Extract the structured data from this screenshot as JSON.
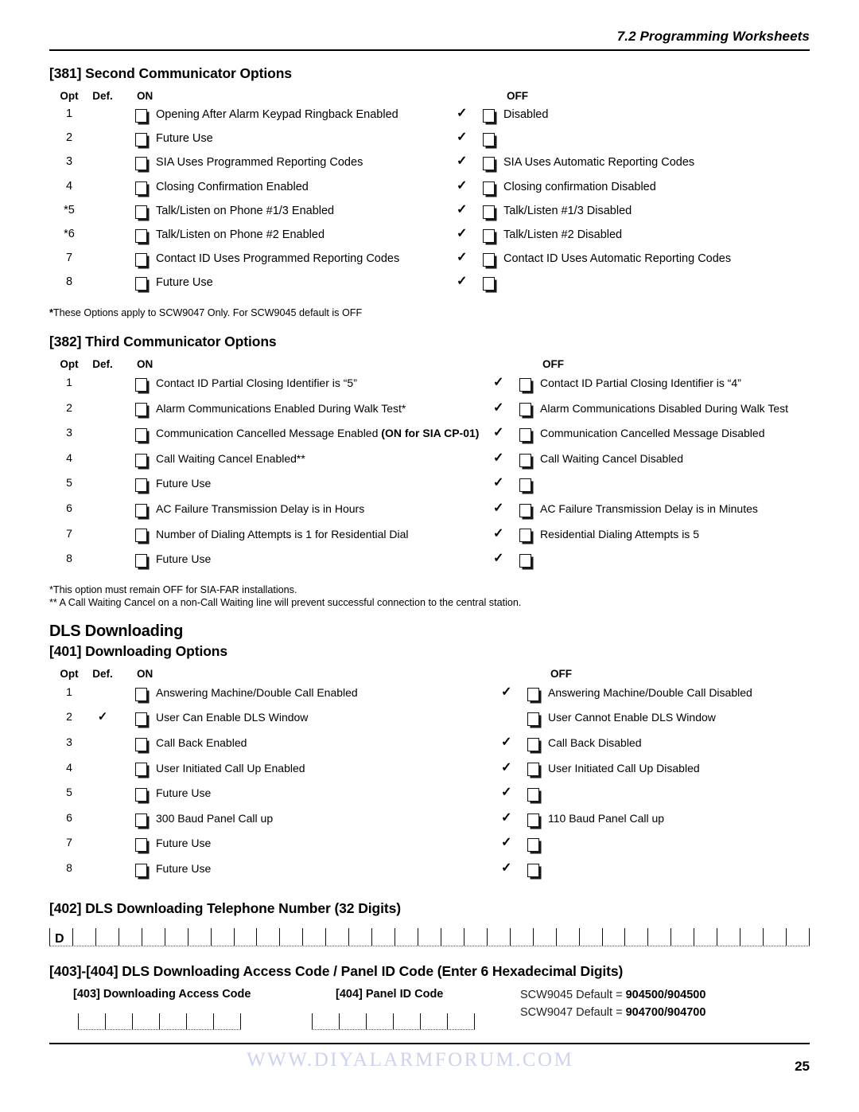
{
  "header": {
    "running_title": "7.2 Programming Worksheets"
  },
  "columns": {
    "opt": "Opt",
    "def": "Def.",
    "on": "ON",
    "off": "OFF"
  },
  "icons": {
    "checkmark": "✓"
  },
  "sections": [
    {
      "id": "381",
      "title": "[381] Second Communicator Options",
      "rows": [
        {
          "opt": "1",
          "def_check": false,
          "on_text": "Opening After Alarm Keypad Ringback Enabled",
          "on_bold": "",
          "off_check": true,
          "off_text": "Disabled"
        },
        {
          "opt": "2",
          "def_check": false,
          "on_text": "Future Use",
          "on_bold": "",
          "off_check": true,
          "off_text": ""
        },
        {
          "opt": "3",
          "def_check": false,
          "on_text": "SIA Uses Programmed Reporting Codes",
          "on_bold": "",
          "off_check": true,
          "off_text": "SIA Uses Automatic Reporting Codes"
        },
        {
          "opt": "4",
          "def_check": false,
          "on_text": "Closing Confirmation Enabled",
          "on_bold": "",
          "off_check": true,
          "off_text": "Closing confirmation Disabled"
        },
        {
          "opt": "*5",
          "def_check": false,
          "on_text": "Talk/Listen on Phone #1/3 Enabled",
          "on_bold": "",
          "off_check": true,
          "off_text": "Talk/Listen #1/3 Disabled"
        },
        {
          "opt": "*6",
          "def_check": false,
          "on_text": "Talk/Listen on Phone #2 Enabled",
          "on_bold": "",
          "off_check": true,
          "off_text": "Talk/Listen #2 Disabled"
        },
        {
          "opt": "7",
          "def_check": false,
          "on_text": "Contact ID Uses Programmed Reporting Codes",
          "on_bold": "",
          "off_check": true,
          "off_text": "Contact ID Uses Automatic Reporting Codes"
        },
        {
          "opt": "8",
          "def_check": false,
          "on_text": "Future Use",
          "on_bold": "",
          "off_check": true,
          "off_text": ""
        }
      ],
      "footnotes": [
        {
          "star": "*",
          "text": "These Options apply to SCW9047 Only. For SCW9045 default is OFF"
        }
      ]
    },
    {
      "id": "382",
      "title": "[382] Third Communicator Options",
      "rows": [
        {
          "opt": "1",
          "def_check": false,
          "on_text": "Contact ID Partial Closing Identifier is “5”",
          "on_bold": "",
          "off_check": true,
          "off_text": "Contact ID Partial Closing Identifier is “4”"
        },
        {
          "opt": "2",
          "def_check": false,
          "on_text": "Alarm Communications Enabled During Walk Test*",
          "on_bold": "",
          "off_check": true,
          "off_text": "Alarm Communications Disabled During Walk Test"
        },
        {
          "opt": "3",
          "def_check": false,
          "on_text": "Communication Cancelled Message Enabled ",
          "on_bold": "(ON for SIA CP-01)",
          "off_check": true,
          "off_text": "Communication Cancelled Message Disabled"
        },
        {
          "opt": "4",
          "def_check": false,
          "on_text": "Call Waiting Cancel Enabled**",
          "on_bold": "",
          "off_check": true,
          "off_text": "Call Waiting Cancel Disabled"
        },
        {
          "opt": "5",
          "def_check": false,
          "on_text": "Future Use",
          "on_bold": "",
          "off_check": true,
          "off_text": ""
        },
        {
          "opt": "6",
          "def_check": false,
          "on_text": "AC Failure Transmission Delay is in Hours",
          "on_bold": "",
          "off_check": true,
          "off_text": "AC Failure Transmission Delay is in Minutes"
        },
        {
          "opt": "7",
          "def_check": false,
          "on_text": "Number of Dialing Attempts is 1 for Residential Dial",
          "on_bold": "",
          "off_check": true,
          "off_text": "Residential Dialing Attempts is 5"
        },
        {
          "opt": "8",
          "def_check": false,
          "on_text": "Future Use",
          "on_bold": "",
          "off_check": true,
          "off_text": ""
        }
      ],
      "footnotes": [
        {
          "star": "",
          "text": "*This option must remain OFF for SIA-FAR installations."
        },
        {
          "star": "",
          "text": "** A Call Waiting Cancel on a non-Call Waiting line will prevent successful connection to the central station."
        }
      ]
    },
    {
      "id": "401",
      "group_title": "DLS Downloading",
      "title": "[401] Downloading Options",
      "rows": [
        {
          "opt": "1",
          "def_check": false,
          "on_text": "Answering Machine/Double Call Enabled",
          "on_bold": "",
          "off_check": true,
          "off_text": "Answering Machine/Double Call Disabled"
        },
        {
          "opt": "2",
          "def_check": true,
          "on_text": "User Can Enable DLS Window",
          "on_bold": "",
          "off_check": false,
          "off_text": "User Cannot Enable DLS Window"
        },
        {
          "opt": "3",
          "def_check": false,
          "on_text": "Call Back Enabled",
          "on_bold": "",
          "off_check": true,
          "off_text": "Call Back Disabled"
        },
        {
          "opt": "4",
          "def_check": false,
          "on_text": "User Initiated Call Up Enabled",
          "on_bold": "",
          "off_check": true,
          "off_text": "User Initiated Call Up Disabled"
        },
        {
          "opt": "5",
          "def_check": false,
          "on_text": "Future Use",
          "on_bold": "",
          "off_check": true,
          "off_text": ""
        },
        {
          "opt": "6",
          "def_check": false,
          "on_text": "300 Baud Panel Call up",
          "on_bold": "",
          "off_check": true,
          "off_text": "110 Baud Panel Call up"
        },
        {
          "opt": "7",
          "def_check": false,
          "on_text": "Future Use",
          "on_bold": "",
          "off_check": true,
          "off_text": ""
        },
        {
          "opt": "8",
          "def_check": false,
          "on_text": "Future Use",
          "on_bold": "",
          "off_check": true,
          "off_text": ""
        }
      ],
      "footnotes": []
    }
  ],
  "phone_section": {
    "title": "[402] DLS Downloading Telephone Number (32 Digits)",
    "prefix_char": "D",
    "cell_count": 33
  },
  "code_section": {
    "title": "[403]-[404] DLS Downloading Access Code / Panel ID Code (Enter 6 Hexadecimal Digits)",
    "access_code_label": "[403] Downloading Access Code",
    "panel_id_label": "[404] Panel ID Code",
    "cell_count": 6,
    "defaults": [
      {
        "prefix": "SCW9045 Default = ",
        "value": "904500/904500"
      },
      {
        "prefix": "SCW9047 Default = ",
        "value": "904700/904700"
      }
    ]
  },
  "footer": {
    "watermark": "WWW.DIYALARMFORUM.COM",
    "page_number": "25"
  }
}
